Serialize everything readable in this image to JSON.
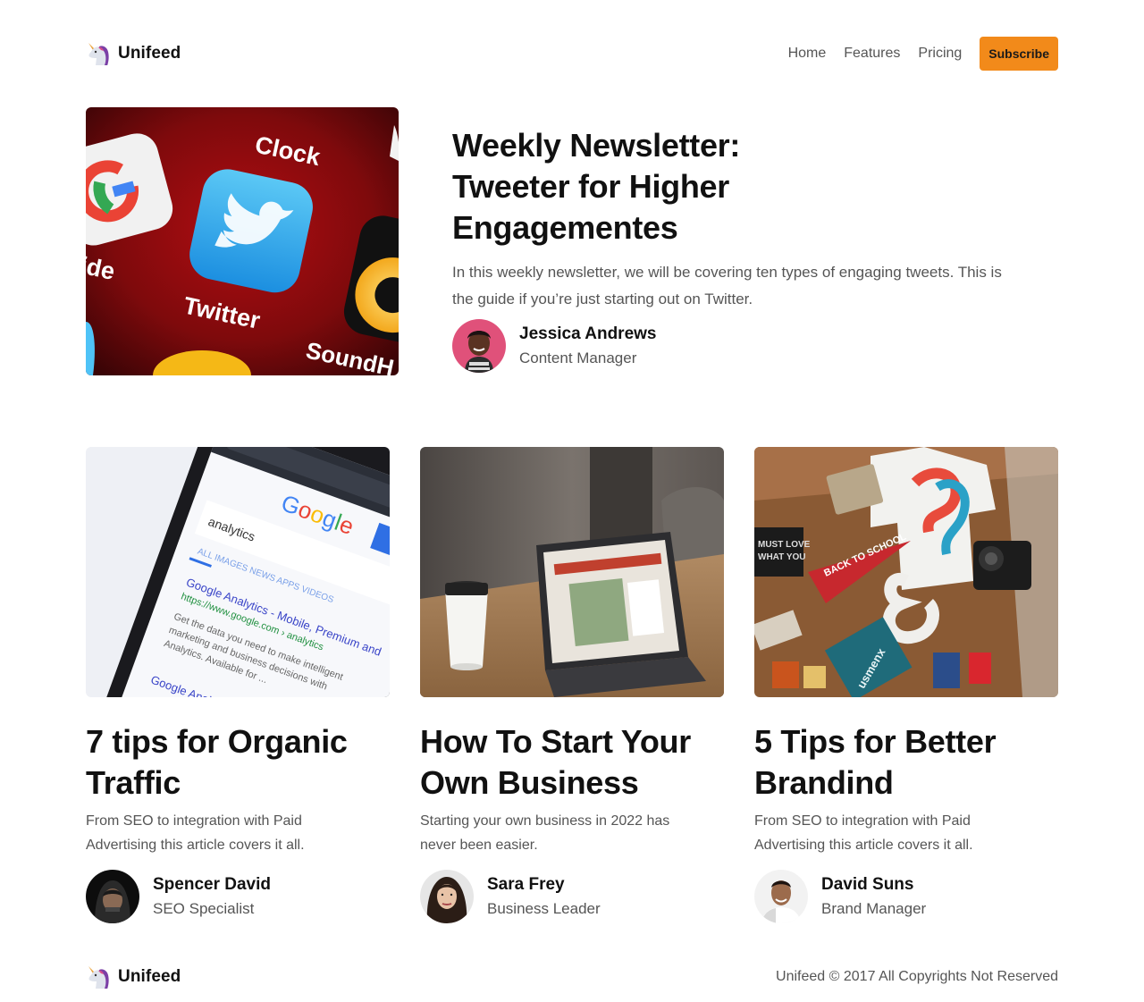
{
  "brand": {
    "name": "Unifeed",
    "icon": "unicorn-icon"
  },
  "nav": {
    "items": [
      "Home",
      "Features",
      "Pricing"
    ],
    "subscribe_label": "Subscribe"
  },
  "hero": {
    "image": "app-icons-photo",
    "title": "Weekly Newsletter: Tweeter for Higher Engagementes",
    "description": "In this weekly newsletter, we will be covering ten types of engaging tweets. This is the guide if you’re just starting out on Twitter.",
    "author": {
      "name": "Jessica Andrews",
      "role": "Content Manager"
    }
  },
  "articles": [
    {
      "image": "phone-search-photo",
      "title": "7 tips for Organic Traffic",
      "description": "From SEO to integration with Paid Advertising this article covers it all.",
      "author": {
        "name": "Spencer David",
        "role": "SEO Specialist"
      }
    },
    {
      "image": "laptop-coffee-photo",
      "title": "How To Start Your Own Business",
      "description": "Starting your own business in 2022 has never been easier.",
      "author": {
        "name": "Sara Frey",
        "role": "Business Leader"
      }
    },
    {
      "image": "branding-desk-photo",
      "title": "5 Tips for Better Brandind",
      "description": "From SEO to integration with Paid Advertising this article covers it all.",
      "author": {
        "name": "David Suns",
        "role": "Brand Manager"
      }
    }
  ],
  "footer": {
    "brand": "Unifeed",
    "copyright": "Unifeed © 2017 All Copyrights Not Reserved"
  },
  "colors": {
    "accent": "#f28a1a",
    "text": "#111111",
    "muted": "#555555"
  }
}
